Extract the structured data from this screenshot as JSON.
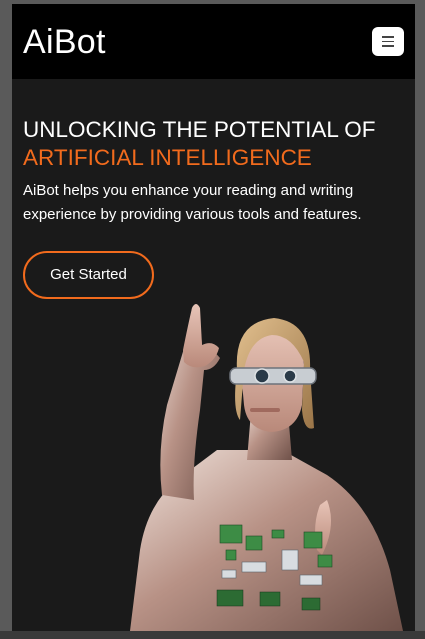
{
  "navbar": {
    "brand": "AiBot",
    "menu_icon": "hamburger-menu-icon"
  },
  "hero": {
    "title_line1": "UNLOCKING THE POTENTIAL OF",
    "title_line2": "ARTIFICIAL INTELLIGENCE",
    "description": "AiBot helps you enhance your reading and writing experience by providing various tools and features.",
    "cta_label": "Get Started",
    "image": "woman-in-metallic-suit-with-ar-glasses"
  },
  "colors": {
    "accent": "#f26b1d",
    "background": "#1a1a1a",
    "navbar": "#000000"
  }
}
